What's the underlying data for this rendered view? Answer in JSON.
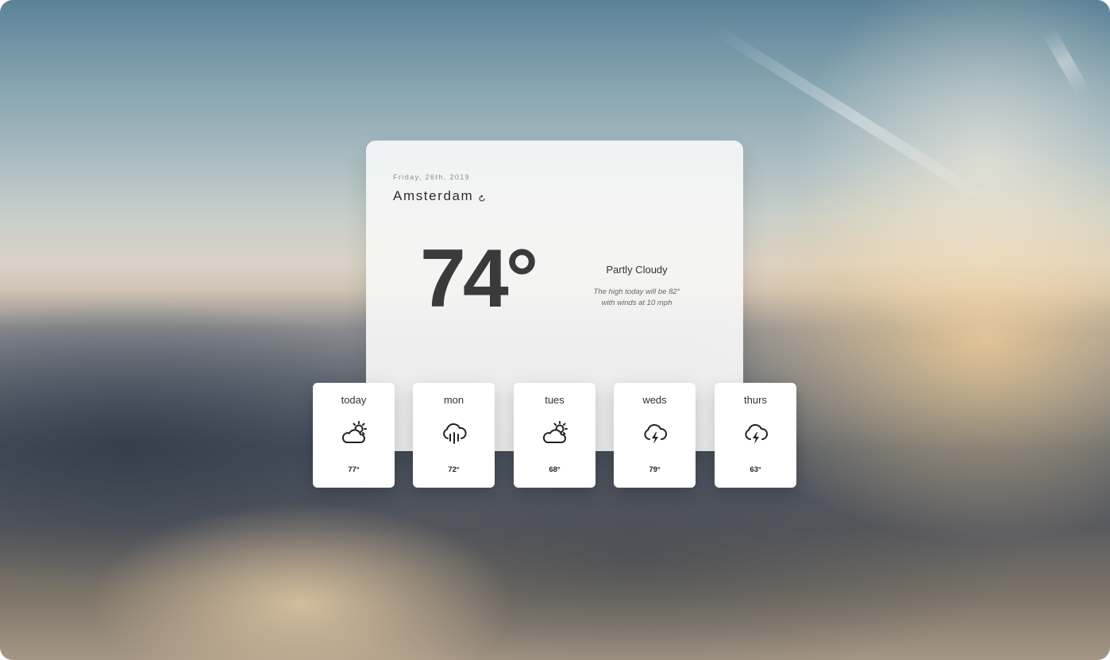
{
  "weather": {
    "date": "Friday, 26th, 2019",
    "city": "Amsterdam",
    "temperature": "74°",
    "condition": "Partly Cloudy",
    "description_line1": "The high today will be 82°",
    "description_line2": "with winds at 10 mph"
  },
  "forecast": [
    {
      "day": "today",
      "icon": "partly-cloudy-icon",
      "temp": "77°"
    },
    {
      "day": "mon",
      "icon": "rain-icon",
      "temp": "72°"
    },
    {
      "day": "tues",
      "icon": "partly-cloudy-icon",
      "temp": "68°"
    },
    {
      "day": "weds",
      "icon": "thunderstorm-icon",
      "temp": "79°"
    },
    {
      "day": "thurs",
      "icon": "thunderstorm-icon",
      "temp": "63°"
    }
  ],
  "colors": {
    "card_bg": "#f6f6f6",
    "text_dark": "#3a3a3a",
    "text_muted": "#8c8c8c"
  }
}
